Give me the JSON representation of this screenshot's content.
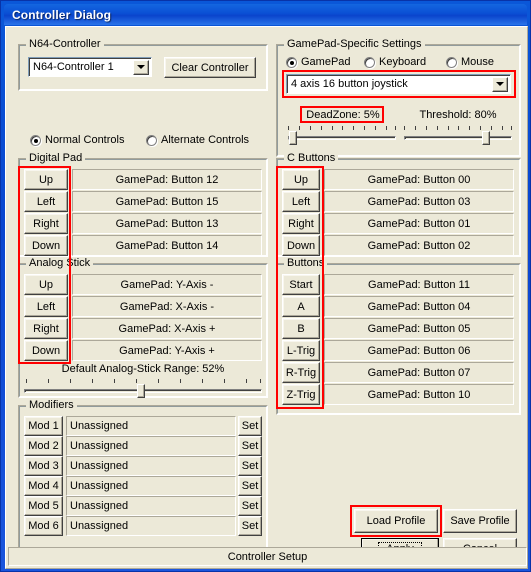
{
  "window": {
    "title": "Controller Dialog",
    "status": "Controller Setup"
  },
  "n64": {
    "group_label": "N64-Controller",
    "combo_value": "N64-Controller 1",
    "clear_button": "Clear Controller",
    "radios": [
      {
        "label": "Normal Controls",
        "selected": true
      },
      {
        "label": "Alternate Controls",
        "selected": false
      }
    ]
  },
  "gamepad_settings": {
    "group_label": "GamePad-Specific Settings",
    "radios": [
      {
        "label": "GamePad",
        "selected": true
      },
      {
        "label": "Keyboard",
        "selected": false
      },
      {
        "label": "Mouse",
        "selected": false
      }
    ],
    "device_combo_value": "4 axis 16 button joystick",
    "deadzone_label": "DeadZone: 5%",
    "deadzone_value": 5,
    "threshold_label": "Threshold: 80%",
    "threshold_value": 80
  },
  "digital_pad": {
    "group_label": "Digital Pad",
    "rows": [
      {
        "button": "Up",
        "binding": "GamePad: Button 12"
      },
      {
        "button": "Left",
        "binding": "GamePad: Button 15"
      },
      {
        "button": "Right",
        "binding": "GamePad: Button 13"
      },
      {
        "button": "Down",
        "binding": "GamePad: Button 14"
      }
    ]
  },
  "analog_stick": {
    "group_label": "Analog Stick",
    "rows": [
      {
        "button": "Up",
        "binding": "GamePad: Y-Axis -"
      },
      {
        "button": "Left",
        "binding": "GamePad: X-Axis -"
      },
      {
        "button": "Right",
        "binding": "GamePad: X-Axis +"
      },
      {
        "button": "Down",
        "binding": "GamePad: Y-Axis +"
      }
    ],
    "range_label": "Default Analog-Stick Range: 52%",
    "range_value": 52
  },
  "c_buttons": {
    "group_label": "C Buttons",
    "rows": [
      {
        "button": "Up",
        "binding": "GamePad: Button 00"
      },
      {
        "button": "Left",
        "binding": "GamePad: Button 03"
      },
      {
        "button": "Right",
        "binding": "GamePad: Button 01"
      },
      {
        "button": "Down",
        "binding": "GamePad: Button 02"
      }
    ]
  },
  "buttons_group": {
    "group_label": "Buttons",
    "rows": [
      {
        "button": "Start",
        "binding": "GamePad: Button 11"
      },
      {
        "button": "A",
        "binding": "GamePad: Button 04"
      },
      {
        "button": "B",
        "binding": "GamePad: Button 05"
      },
      {
        "button": "L-Trig",
        "binding": "GamePad: Button 06"
      },
      {
        "button": "R-Trig",
        "binding": "GamePad: Button 07"
      },
      {
        "button": "Z-Trig",
        "binding": "GamePad: Button 10"
      }
    ]
  },
  "modifiers": {
    "group_label": "Modifiers",
    "set_label": "Set",
    "rows": [
      {
        "button": "Mod 1",
        "value": "Unassigned"
      },
      {
        "button": "Mod 2",
        "value": "Unassigned"
      },
      {
        "button": "Mod 3",
        "value": "Unassigned"
      },
      {
        "button": "Mod 4",
        "value": "Unassigned"
      },
      {
        "button": "Mod 5",
        "value": "Unassigned"
      },
      {
        "button": "Mod 6",
        "value": "Unassigned"
      }
    ]
  },
  "actions": {
    "load_profile": "Load Profile",
    "save_profile": "Save Profile",
    "apply": "Apply",
    "cancel": "Cancel"
  },
  "colors": {
    "accent": "#0a4fd4",
    "face": "#ece9d8",
    "highlight": "#ff0000"
  }
}
